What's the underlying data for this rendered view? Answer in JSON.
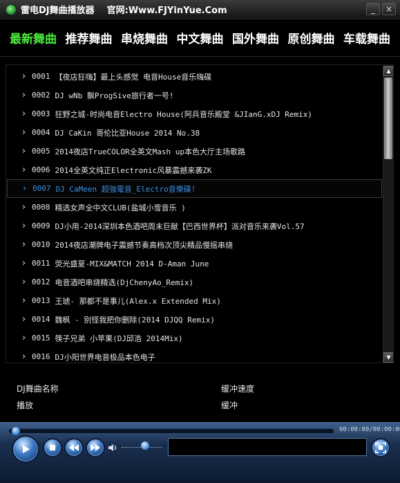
{
  "window": {
    "title": "雷电DJ舞曲播放器",
    "site": "官网:Www.FJYinYue.Com",
    "min_label": "_",
    "close_label": "×"
  },
  "tabs": [
    {
      "label": "最新舞曲",
      "active": true
    },
    {
      "label": "推荐舞曲"
    },
    {
      "label": "串烧舞曲"
    },
    {
      "label": "中文舞曲"
    },
    {
      "label": "国外舞曲"
    },
    {
      "label": "原创舞曲"
    },
    {
      "label": "车载舞曲"
    }
  ],
  "playlist": {
    "selected_index": 6,
    "items": [
      {
        "num": "0001",
        "title": "【夜店狂嗨】最上头感觉 电音House音乐嗨碟"
      },
      {
        "num": "0002",
        "title": "DJ wNb 飘ProgSive旅行者一号!"
      },
      {
        "num": "0003",
        "title": "狂野之城-时尚电音Electro House(阿兵音乐殿堂 &JIanG.xDJ Remix)"
      },
      {
        "num": "0004",
        "title": "DJ CaKin 哥伦比亚House 2014 No.38"
      },
      {
        "num": "0005",
        "title": "2014夜店TrueCOLOR全英文Mash up本色大厅主场歌路"
      },
      {
        "num": "0006",
        "title": "2014全英文纯正Electronic风暴震撼来袭ZK"
      },
      {
        "num": "0007",
        "title": "DJ CaMeen 超強電音_Electro音樂碟!"
      },
      {
        "num": "0008",
        "title": "精选女声全中文CLUB(盐城小雪音乐 )"
      },
      {
        "num": "0009",
        "title": "DJ小用-2014深圳本色酒吧周末巨献【巴西世界杯】派对音乐来袭Vol.57"
      },
      {
        "num": "0010",
        "title": "2014夜店潮牌电子震撼节奏高档次顶尖精品慢摇串烧"
      },
      {
        "num": "0011",
        "title": "荧光盛夏-MIX&MATCH 2014 D-Aman June"
      },
      {
        "num": "0012",
        "title": "电音酒吧串烧精选(DjChenyAo_Remix)"
      },
      {
        "num": "0013",
        "title": "王琥- 那都不是事儿(Alex.x Extended Mix)"
      },
      {
        "num": "0014",
        "title": "魏枫 - 别怪我把你删除(2014 DJQQ Remix)"
      },
      {
        "num": "0015",
        "title": "筷子兄弟 小苹果(DJ邱浩 2014Mix)"
      },
      {
        "num": "0016",
        "title": "DJ小阳世界电音极品本色电子"
      }
    ]
  },
  "info": {
    "name_label": "DJ舞曲名称",
    "speed_label": "缓冲速度",
    "play_label": "播放",
    "buffer_label": "缓冲"
  },
  "player": {
    "time": "00:00:00/00:00:00",
    "display_text": ""
  },
  "icons": {
    "chevron": "chevron-right-icon",
    "play": "play-icon",
    "stop": "stop-icon",
    "prev": "previous-icon",
    "next": "next-icon",
    "volume": "speaker-icon",
    "fullscreen": "fullscreen-icon"
  },
  "colors": {
    "active_tab": "#4dea3c",
    "selected_row": "#3a8fe0",
    "text": "#e6e6e6"
  }
}
